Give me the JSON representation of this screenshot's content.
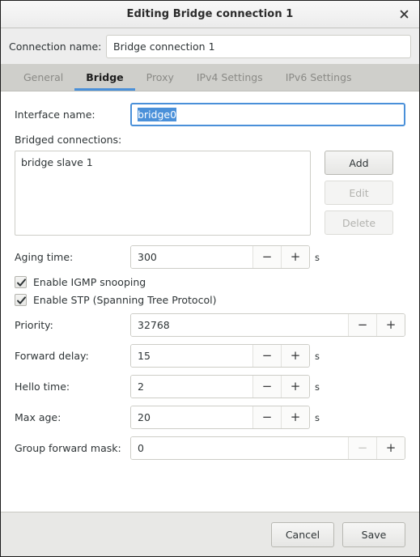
{
  "window": {
    "title": "Editing Bridge connection 1",
    "close_icon": "close-icon"
  },
  "connection": {
    "label": "Connection name:",
    "value": "Bridge connection 1",
    "placeholder": ""
  },
  "tabs": [
    {
      "label": "General",
      "active": false
    },
    {
      "label": "Bridge",
      "active": true
    },
    {
      "label": "Proxy",
      "active": false
    },
    {
      "label": "IPv4 Settings",
      "active": false
    },
    {
      "label": "IPv6 Settings",
      "active": false
    }
  ],
  "bridge": {
    "interface": {
      "label": "Interface name:",
      "value": "bridge0",
      "selected": true
    },
    "bridged_connections": {
      "label": "Bridged connections:",
      "items": [
        "bridge slave 1"
      ],
      "buttons": [
        {
          "label": "Add",
          "enabled": true
        },
        {
          "label": "Edit",
          "enabled": false
        },
        {
          "label": "Delete",
          "enabled": false
        }
      ]
    },
    "aging_time": {
      "label": "Aging time:",
      "value": "300",
      "unit": "s",
      "minus": "−",
      "plus": "+",
      "minus_enabled": true,
      "plus_enabled": true
    },
    "igmp_snooping": {
      "label": "Enable IGMP snooping",
      "checked": true
    },
    "stp": {
      "label": "Enable STP (Spanning Tree Protocol)",
      "checked": true
    },
    "priority": {
      "label": "Priority:",
      "value": "32768",
      "unit": "",
      "minus": "−",
      "plus": "+",
      "minus_enabled": true,
      "plus_enabled": true
    },
    "forward_delay": {
      "label": "Forward delay:",
      "value": "15",
      "unit": "s",
      "minus": "−",
      "plus": "+",
      "minus_enabled": true,
      "plus_enabled": true
    },
    "hello_time": {
      "label": "Hello time:",
      "value": "2",
      "unit": "s",
      "minus": "−",
      "plus": "+",
      "minus_enabled": true,
      "plus_enabled": true
    },
    "max_age": {
      "label": "Max age:",
      "value": "20",
      "unit": "s",
      "minus": "−",
      "plus": "+",
      "minus_enabled": true,
      "plus_enabled": true
    },
    "group_forward_mask": {
      "label": "Group forward mask:",
      "value": "0",
      "unit": "",
      "minus": "−",
      "plus": "+",
      "minus_enabled": false,
      "plus_enabled": true
    }
  },
  "footer": {
    "cancel_label": "Cancel",
    "save_label": "Save"
  },
  "colors": {
    "accent": "#4a90d9",
    "tabbar_bg": "#cfcfcb",
    "dialog_bg": "#ededed",
    "content_bg": "#ffffff",
    "footer_bg": "#e8e8e6"
  }
}
